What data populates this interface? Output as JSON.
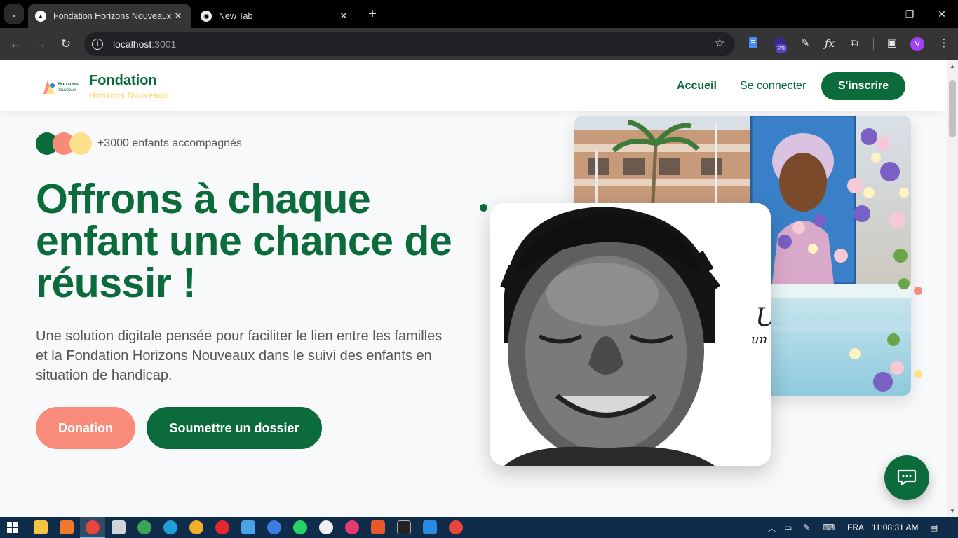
{
  "browser": {
    "tabs": [
      {
        "title": "Fondation Horizons Nouveaux",
        "active": true
      },
      {
        "title": "New Tab",
        "active": false
      }
    ],
    "url_host": "localhost",
    "url_port": ":3001",
    "extension_badge": "29",
    "profile_initial": "V"
  },
  "site": {
    "brand_name": "Fondation",
    "brand_sub": "Horizons Nouveaux",
    "logo_text": "Horizons nouveaux",
    "nav": {
      "home": "Accueil",
      "login": "Se connecter",
      "signup": "S'inscrire"
    }
  },
  "hero": {
    "kids_count": "+3000 enfants accompagnés",
    "title": "Offrons à chaque enfant une chance de réussir !",
    "description": "Une solution digitale pensée pour faciliter le lien entre les familles et la Fondation Horizons Nouveaux dans le suivi des enfants en situation de handicap.",
    "btn_donation": "Donation",
    "btn_dossier": "Soumettre un dossier",
    "handwriting": "U un"
  },
  "colors": {
    "primary": "#0b6b3a",
    "coral": "#f98b7a",
    "yellow": "#fde08b"
  },
  "taskbar": {
    "language": "FRA",
    "time": "11:08:31 AM"
  }
}
